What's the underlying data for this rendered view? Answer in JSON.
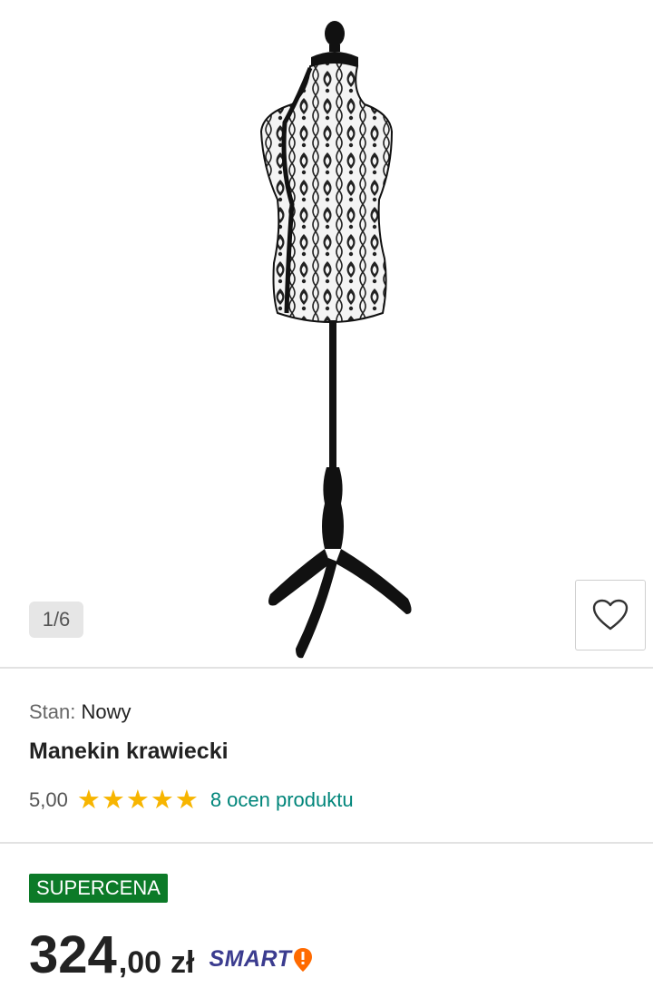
{
  "gallery": {
    "counter": "1/6",
    "image_alt": "mannequin-icon",
    "wishlist_icon": "heart-icon"
  },
  "product": {
    "condition_label": "Stan:",
    "condition_value": "Nowy",
    "title": "Manekin krawiecki",
    "rating_value": "5,00",
    "rating_stars": 5,
    "reviews_link": "8 ocen produktu"
  },
  "pricing": {
    "badge": "SUPERCENA",
    "price_int": "324",
    "price_dec": ",00",
    "currency": "zł",
    "smart_label": "SMART"
  },
  "colors": {
    "badge_bg": "#0c7a28",
    "star": "#f7b500",
    "link": "#00857a",
    "smart": "#3b3c8f",
    "smart_accent": "#ff6a00"
  }
}
